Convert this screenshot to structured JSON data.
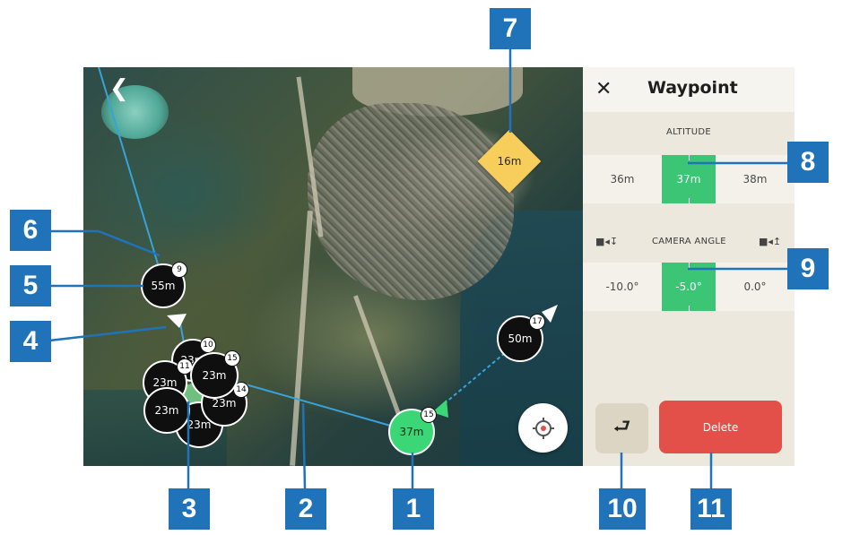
{
  "map": {
    "back_icon": "chevron-left-icon",
    "waypoints": [
      {
        "label": "55m",
        "index": "9"
      },
      {
        "label": "50m",
        "index": "17"
      },
      {
        "label": "37m",
        "index": "15"
      },
      {
        "label": "23m",
        "index": "10"
      },
      {
        "label": "23m",
        "index": "11"
      },
      {
        "label": "23m",
        "index": "15"
      },
      {
        "label": "23m",
        "index": "14"
      },
      {
        "label": "23m",
        "index": ""
      },
      {
        "label": "23m",
        "index": ""
      }
    ],
    "poi": {
      "label": "16m"
    },
    "recenter_icon": "crosshair-icon"
  },
  "panel": {
    "close_icon": "close-icon",
    "title": "Waypoint",
    "altitude": {
      "label": "ALTITUDE",
      "options": [
        "36m",
        "37m",
        "38m"
      ],
      "selected": "37m"
    },
    "camera_angle": {
      "label": "CAMERA ANGLE",
      "options": [
        "-10.0°",
        "-5.0°",
        "0.0°"
      ],
      "selected": "-5.0°",
      "left_icon": "camera-down-icon",
      "right_icon": "camera-up-icon"
    },
    "undo_icon": "undo-icon",
    "delete_label": "Delete"
  },
  "callouts": [
    "1",
    "2",
    "3",
    "4",
    "5",
    "6",
    "7",
    "8",
    "9",
    "10",
    "11"
  ],
  "colors": {
    "callout": "#2073b9",
    "selected_green": "#3bc574",
    "poi_yellow": "#f7cd5c",
    "delete_red": "#e3504a",
    "waypoint_black": "#0f0f0f"
  }
}
